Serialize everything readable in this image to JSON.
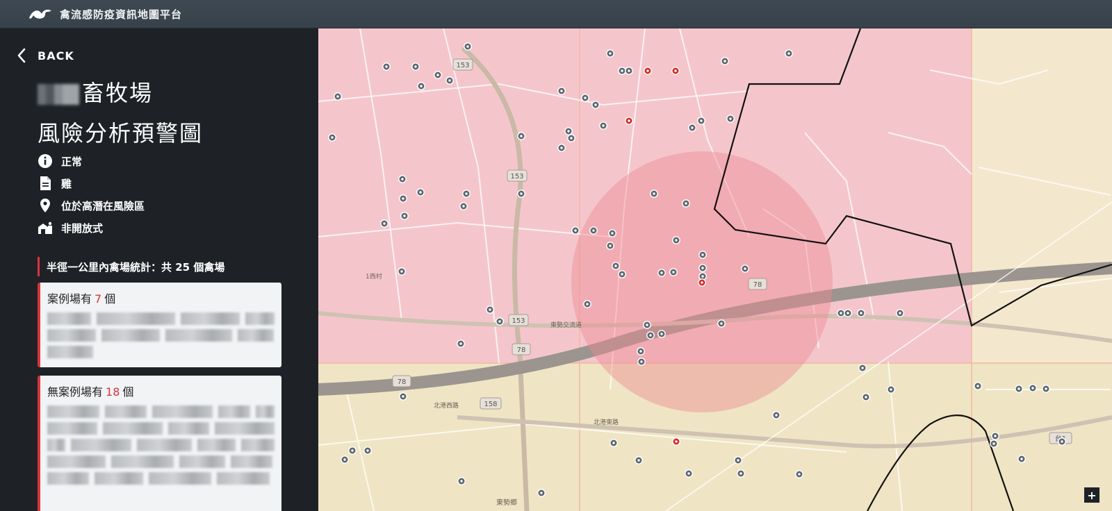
{
  "header": {
    "title": "禽流感防疫資訊地圖平台",
    "logo_icon": "bird-logo-icon"
  },
  "sidebar": {
    "back_label": "BACK",
    "farm_name_suffix": "畜牧場",
    "subtitle": "風險分析預警圖",
    "info": [
      {
        "icon": "info-icon",
        "text": "正常"
      },
      {
        "icon": "document-icon",
        "text": "雞"
      },
      {
        "icon": "location-pin-icon",
        "text": "位於高潛在風險區"
      },
      {
        "icon": "barn-icon",
        "text": "非開放式"
      }
    ],
    "stats_heading": "半徑一公里內禽場統計：共 25 個禽場",
    "case_card": {
      "prefix": "案例場有",
      "count": "7",
      "suffix": "個"
    },
    "no_case_card": {
      "prefix": "無案例場有",
      "count": "18",
      "suffix": "個"
    }
  },
  "map": {
    "zoom_in_label": "+",
    "colors": {
      "high_risk_zone": "#f4c6cc",
      "medium_zone": "#f1e7c6",
      "radius_circle": "#ee8a93",
      "case_farm": "#d42b2b",
      "non_case_farm": "#5c6670",
      "boundary": "#111111"
    },
    "labels": {
      "road_153": "153",
      "road_78": "78",
      "road_tai1": "台1",
      "road_158": "158",
      "place_a": "北港西路",
      "place_b": "北港東路",
      "place_c": "1西村",
      "place_d": "東勢郷",
      "place_e": "東勢交流道"
    }
  }
}
